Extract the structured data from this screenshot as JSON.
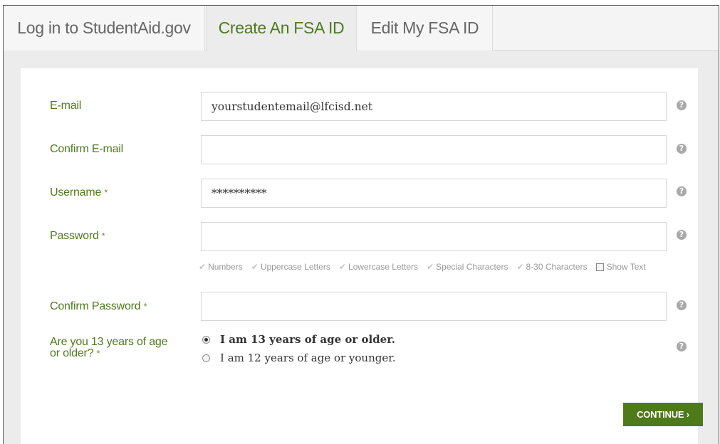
{
  "tabs": [
    {
      "label": "Log in to StudentAid.gov"
    },
    {
      "label": "Create An FSA ID"
    },
    {
      "label": "Edit My FSA ID"
    }
  ],
  "form": {
    "email": {
      "label": "E-mail",
      "value": "yourstudentemail@lfcisd.net"
    },
    "confirm_email": {
      "label": "Confirm E-mail",
      "value": ""
    },
    "username": {
      "label": "Username",
      "required": "*",
      "value": "**********"
    },
    "password": {
      "label": "Password",
      "required": "*",
      "value": ""
    },
    "password_rules": [
      "Numbers",
      "Uppercase Letters",
      "Lowercase Letters",
      "Special Characters",
      "8-30 Characters"
    ],
    "show_text_label": "Show Text",
    "confirm_password": {
      "label": "Confirm Password",
      "required": "*",
      "value": ""
    },
    "age_question": {
      "label_line1": "Are you 13 years of age",
      "label_line2": "or older?",
      "required": "*"
    },
    "age_options": [
      {
        "label": "I am 13 years of age or older.",
        "selected": true
      },
      {
        "label": "I am 12 years of age or younger.",
        "selected": false
      }
    ],
    "help_icon_glyph": "?",
    "continue_label": "CONTINUE ›"
  },
  "colors": {
    "accent_green": "#4e7a19",
    "label_green": "#4f7a1e"
  }
}
